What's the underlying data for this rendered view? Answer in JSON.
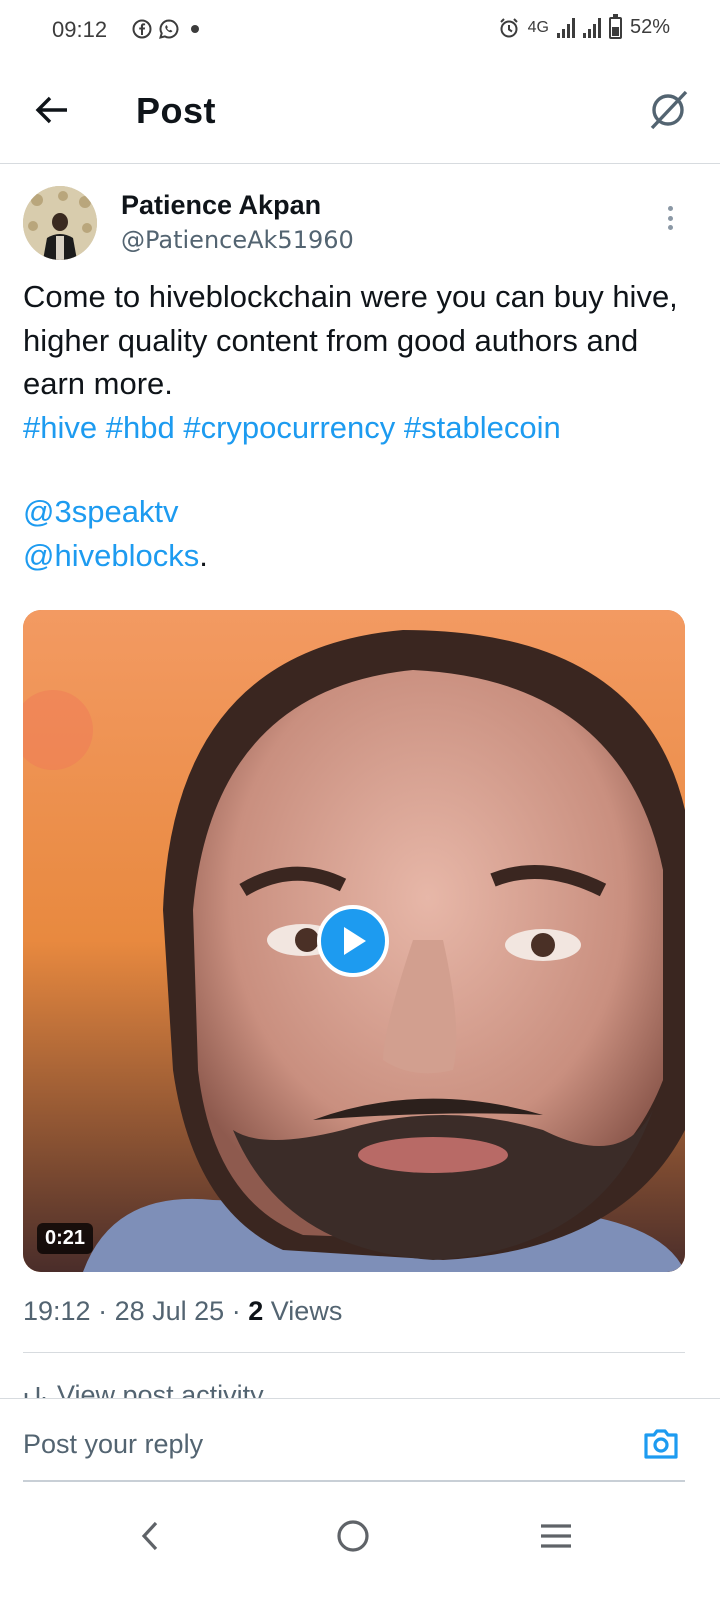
{
  "status_bar": {
    "time": "09:12",
    "network": "4G",
    "battery": "52%",
    "left_icons": [
      "facebook-icon",
      "whatsapp-icon",
      "dot-icon"
    ],
    "right_icons": [
      "alarm-icon",
      "signal-icon",
      "signal-icon",
      "battery-icon"
    ]
  },
  "header": {
    "title": "Post",
    "back_icon": "arrow-left-icon",
    "right_icon": "grok-icon"
  },
  "post": {
    "author_name": "Patience Akpan",
    "author_handle": "@PatienceAk51960",
    "text": "Come to hiveblockchain were you can buy hive, higher quality content from good authors and earn more.",
    "hashtags": [
      "#hive",
      "#hbd",
      "#crypocurrency",
      "#stablecoin"
    ],
    "mentions": [
      "@3speaktv",
      "@hiveblocks"
    ],
    "mentions_trailing": ".",
    "video": {
      "duration": "0:21"
    },
    "time": "19:12",
    "date": "28 Jul 25",
    "views_count": "2",
    "views_label": "Views",
    "separator": "·",
    "activity_label": "View post activity"
  },
  "reply": {
    "placeholder": "Post your reply"
  },
  "nav": {
    "items": [
      "back-icon",
      "home-icon",
      "recents-icon"
    ]
  },
  "colors": {
    "accent": "#1d9bf0",
    "text": "#0f1419",
    "secondary": "#536471",
    "divider": "#d7dbdf"
  }
}
